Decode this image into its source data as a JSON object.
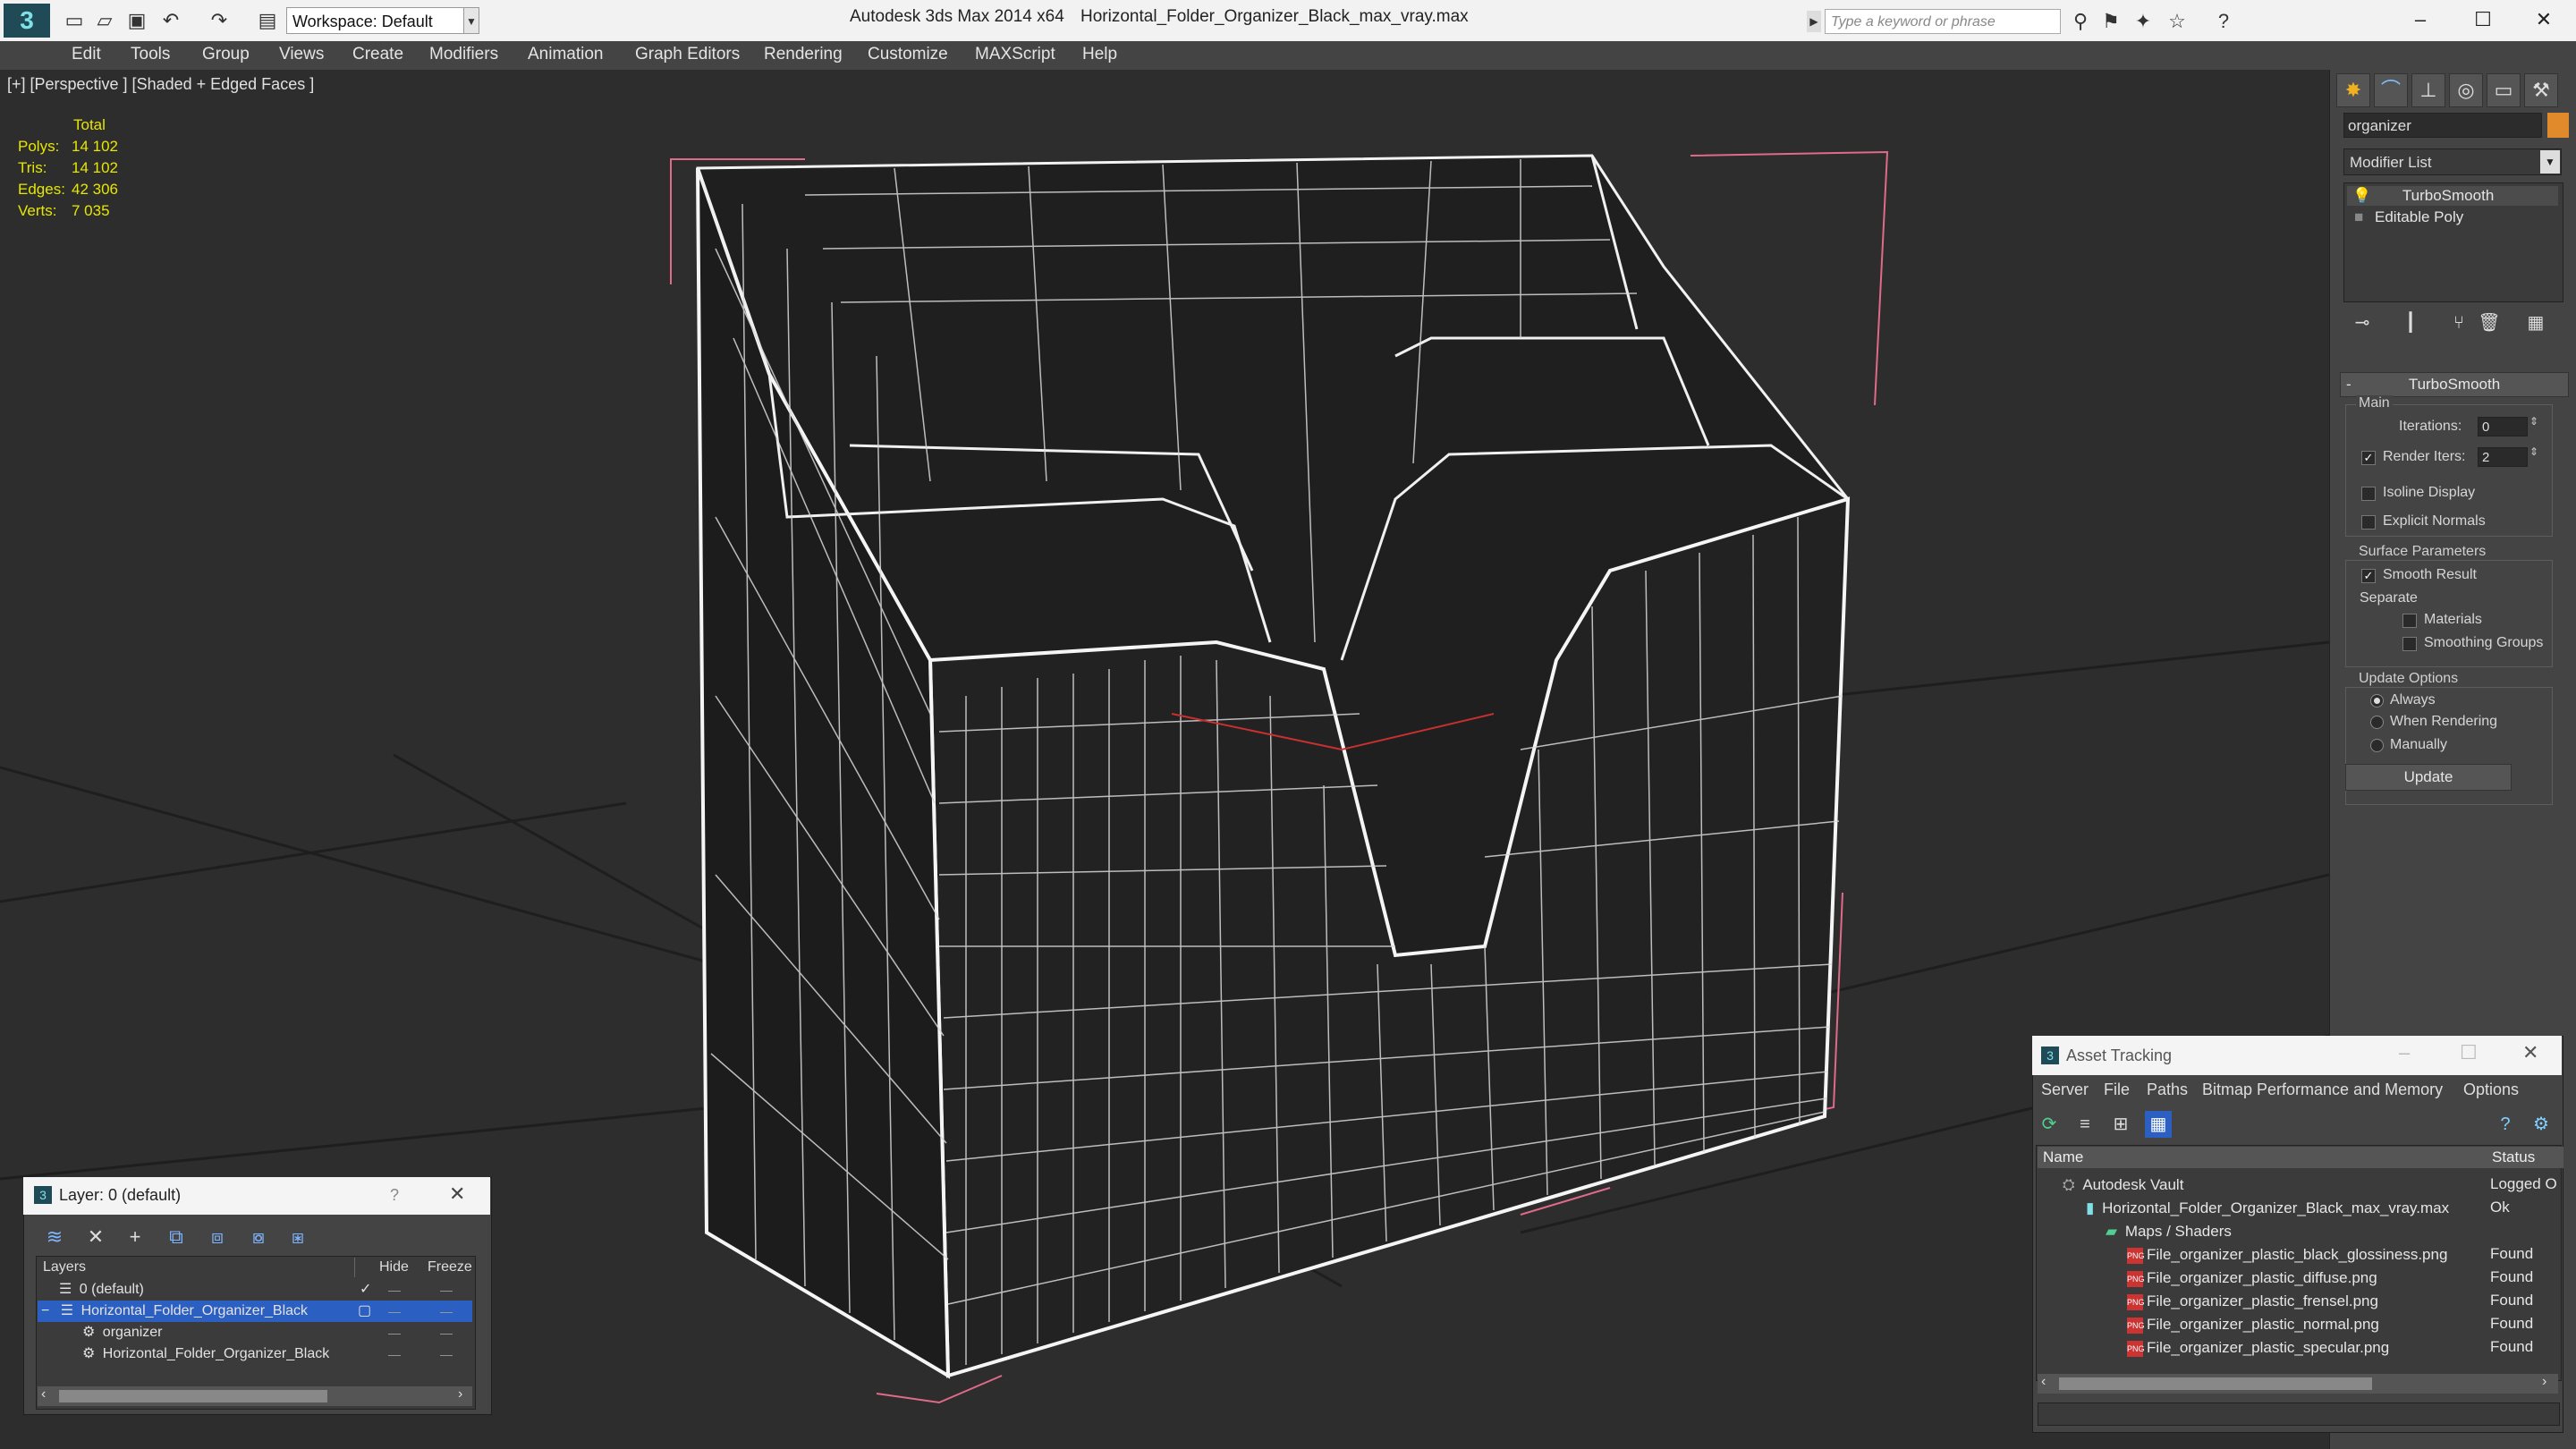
{
  "titlebar": {
    "workspace": "Workspace: Default",
    "app_title": "Autodesk 3ds Max  2014 x64",
    "file_title": "Horizontal_Folder_Organizer_Black_max_vray.max",
    "search_placeholder": "Type a keyword or phrase"
  },
  "menu": [
    "Edit",
    "Tools",
    "Group",
    "Views",
    "Create",
    "Modifiers",
    "Animation",
    "Graph Editors",
    "Rendering",
    "Customize",
    "MAXScript",
    "Help"
  ],
  "viewport": {
    "label": "[+] [Perspective ] [Shaded + Edged Faces ]",
    "stats_header": "Total",
    "stats": [
      {
        "key": "Polys:",
        "value": "14 102"
      },
      {
        "key": "Tris:",
        "value": "14 102"
      },
      {
        "key": "Edges:",
        "value": "42 306"
      },
      {
        "key": "Verts:",
        "value": "7 035"
      }
    ]
  },
  "command_panel": {
    "object_name": "organizer",
    "modifier_list": "Modifier List",
    "stack": [
      "TurboSmooth",
      "Editable Poly"
    ],
    "rollout": "TurboSmooth",
    "main_group": "Main",
    "iterations_label": "Iterations:",
    "iterations_value": "0",
    "render_iters_label": "Render Iters:",
    "render_iters_value": "2",
    "isoline": "Isoline Display",
    "explicit_normals": "Explicit Normals",
    "surface_group": "Surface Parameters",
    "smooth_result": "Smooth Result",
    "separate": "Separate",
    "materials": "Materials",
    "smoothing_groups": "Smoothing Groups",
    "update_group": "Update Options",
    "always": "Always",
    "when_rendering": "When Rendering",
    "manually": "Manually",
    "update_button": "Update"
  },
  "layer_dialog": {
    "title": "Layer: 0 (default)",
    "help": "?",
    "columns": [
      "Layers",
      "Hide",
      "Freeze"
    ],
    "rows": [
      "0 (default)",
      "Horizontal_Folder_Organizer_Black",
      "organizer",
      "Horizontal_Folder_Organizer_Black"
    ]
  },
  "asset_tracking": {
    "title": "Asset Tracking",
    "menu": [
      "Server",
      "File",
      "Paths",
      "Bitmap Performance and Memory",
      "Options"
    ],
    "columns": [
      "Name",
      "Status"
    ],
    "rows": [
      {
        "name": "Autodesk Vault",
        "status": "Logged O"
      },
      {
        "name": "Horizontal_Folder_Organizer_Black_max_vray.max",
        "status": "Ok"
      },
      {
        "name": "Maps / Shaders",
        "status": ""
      },
      {
        "name": "File_organizer_plastic_black_glossiness.png",
        "status": "Found"
      },
      {
        "name": "File_organizer_plastic_diffuse.png",
        "status": "Found"
      },
      {
        "name": "File_organizer_plastic_frensel.png",
        "status": "Found"
      },
      {
        "name": "File_organizer_plastic_normal.png",
        "status": "Found"
      },
      {
        "name": "File_organizer_plastic_specular.png",
        "status": "Found"
      }
    ]
  }
}
